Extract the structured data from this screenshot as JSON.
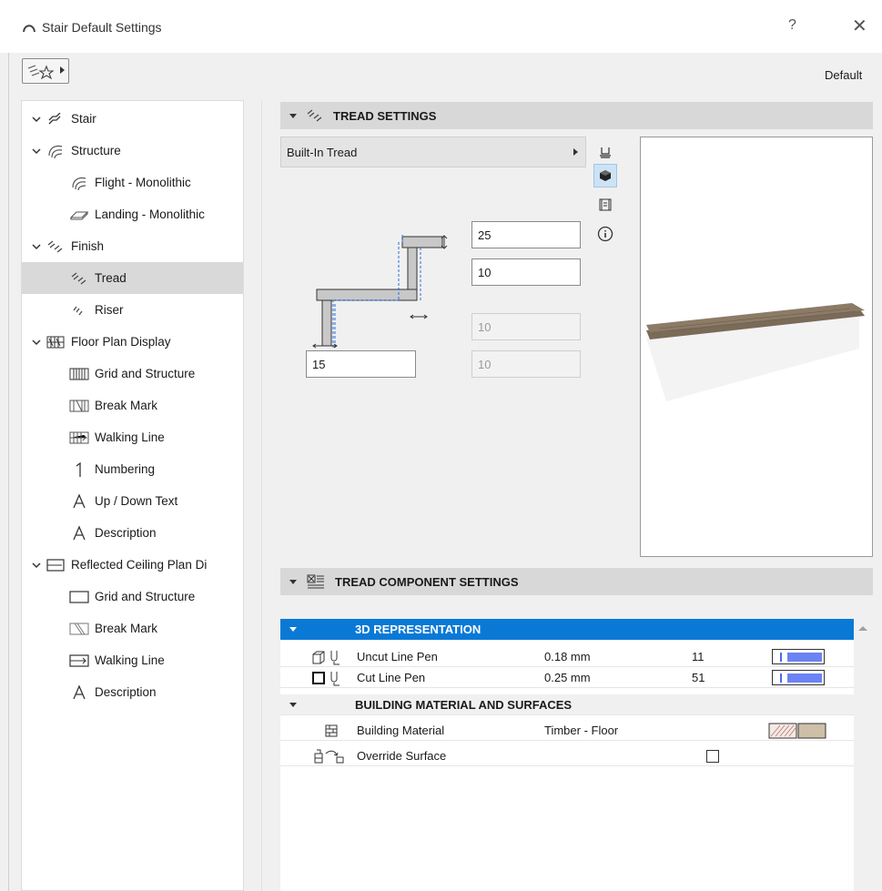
{
  "window": {
    "title": "Stair Default Settings",
    "help": "?",
    "close": "✕"
  },
  "toolbar": {
    "default_label": "Default"
  },
  "tree": {
    "items": [
      {
        "label": "Stair"
      },
      {
        "label": "Structure"
      },
      {
        "label": "Flight - Monolithic"
      },
      {
        "label": "Landing - Monolithic"
      },
      {
        "label": "Finish"
      },
      {
        "label": "Tread"
      },
      {
        "label": "Riser"
      },
      {
        "label": "Floor Plan Display"
      },
      {
        "label": "Grid and Structure"
      },
      {
        "label": "Break Mark"
      },
      {
        "label": "Walking Line"
      },
      {
        "label": "Numbering"
      },
      {
        "label": "Up / Down Text"
      },
      {
        "label": "Description"
      },
      {
        "label": "Reflected Ceiling Plan Di"
      },
      {
        "label": "Grid and Structure"
      },
      {
        "label": "Break Mark"
      },
      {
        "label": "Walking Line"
      },
      {
        "label": "Description"
      }
    ]
  },
  "tread_settings": {
    "header": "TREAD SETTINGS",
    "type": "Built-In Tread",
    "fields": {
      "thickness": "25",
      "nosing": "10",
      "offset_disabled_1": "10",
      "offset_disabled_2": "10",
      "bottom": "15"
    }
  },
  "component_settings": {
    "header": "TREAD COMPONENT SETTINGS",
    "group_3d": "3D REPRESENTATION",
    "rows_3d": [
      {
        "name": "Uncut Line Pen",
        "value": "0.18 mm",
        "pen": "11"
      },
      {
        "name": "Cut Line Pen",
        "value": "0.25 mm",
        "pen": "51"
      }
    ],
    "group_material": "BUILDING MATERIAL AND SURFACES",
    "material_row": {
      "name": "Building Material",
      "value": "Timber - Floor"
    },
    "override_row": {
      "name": "Override Surface"
    }
  },
  "colors": {
    "selection_blue": "#0a79d6",
    "wood": "#7a6a58",
    "material_swatch": "#cdbfa8"
  }
}
